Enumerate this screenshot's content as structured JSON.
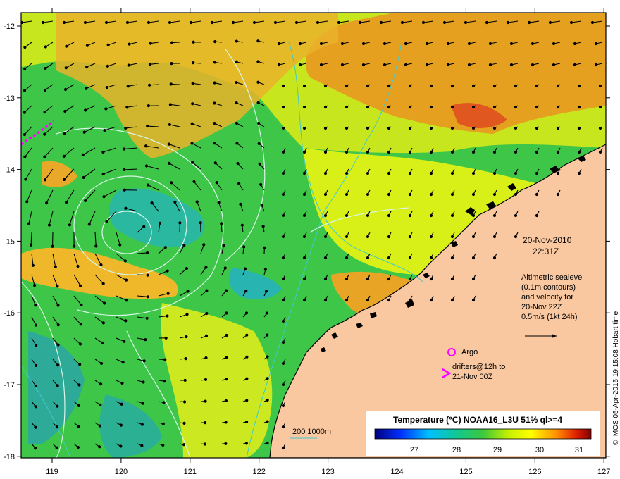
{
  "map": {
    "date": "20-Nov-2010",
    "time": "22:31Z",
    "x_ticks": [
      "119",
      "120",
      "121",
      "122",
      "123",
      "124",
      "125",
      "126",
      "127"
    ],
    "y_ticks": [
      "-12",
      "-13",
      "-14",
      "-15",
      "-16",
      "-17",
      "-18"
    ],
    "altimetry_note": [
      "Altimetric sealevel",
      "(0.1m contours)",
      "and velocity for",
      "20-Nov 22Z",
      "0.5m/s (1kt 24h)"
    ],
    "argo_label": "Argo",
    "drifters_label": [
      "drifters@12h to",
      "21-Nov 00Z"
    ],
    "bathymetry_label": "200  1000m",
    "colorbar": {
      "title": "Temperature (°C) NOAA16_L3U 51% ql>=4",
      "ticks": [
        "27",
        "28",
        "29",
        "30",
        "31"
      ]
    },
    "credit": "© IMOS 05-Apr-2015 19:15:08 Hobart time"
  },
  "colors": {
    "land": "#f9c8a0",
    "coast": "#000000",
    "contour": "#d8f5e8",
    "argo": "#ff00ff",
    "bathymetry": "#40c8d0"
  }
}
